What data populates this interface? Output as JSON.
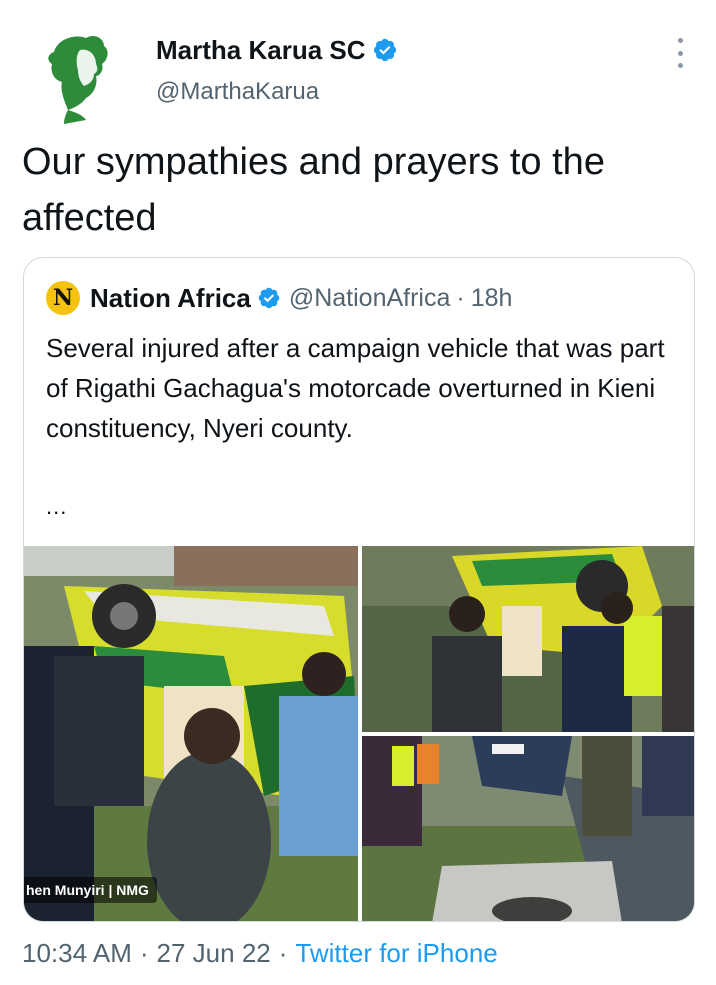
{
  "author": {
    "name": "Martha Karua SC",
    "handle": "@MarthaKarua",
    "verified": true,
    "avatar": "green-silhouette-portrait"
  },
  "tweet": {
    "text": "Our sympathies and prayers to the affected"
  },
  "quoted_tweet": {
    "logo_letter": "N",
    "name": "Nation Africa",
    "verified": true,
    "handle": "@NationAfrica",
    "separator": "·",
    "age": "18h",
    "text": "Several injured after a campaign vehicle that was part of Rigathi Gachagua's motorcade overturned in Kieni constituency, Nyeri county.",
    "ellipsis": "...",
    "photo_credit": "hen Munyiri | NMG"
  },
  "footer": {
    "time": "10:34 AM",
    "dot1": "·",
    "date": "27 Jun 22",
    "dot2": "·",
    "source": "Twitter for iPhone"
  },
  "colors": {
    "link": "#1d9bf0",
    "verified": "#1d9bf0",
    "secondary_text": "#536471",
    "border": "#cfd9de",
    "avatar_green": "#2e8b3a",
    "nation_logo": "#f5c20f"
  },
  "icons": [
    "verified-badge-icon",
    "more-options-icon"
  ]
}
